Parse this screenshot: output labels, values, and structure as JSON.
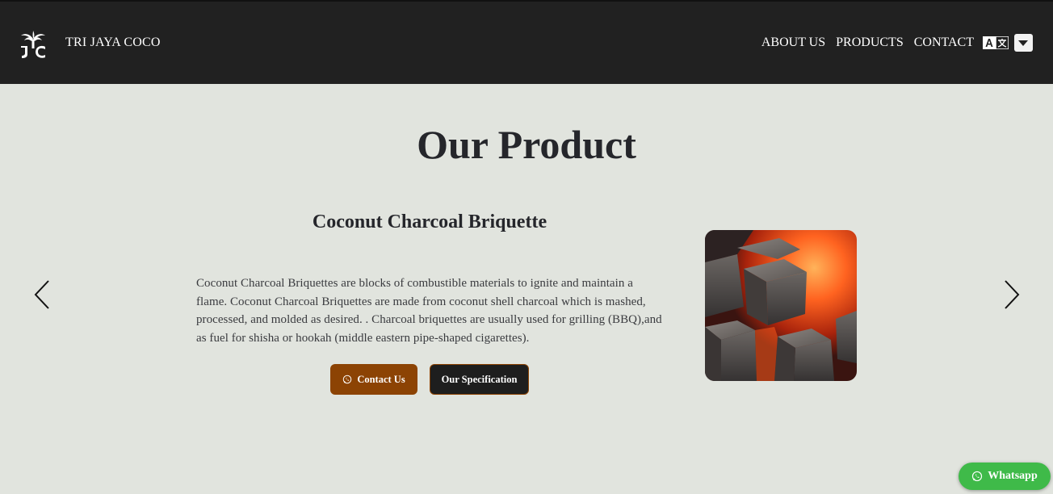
{
  "nav": {
    "brand": "TRI JAYA COCO",
    "logo_icon": "palm-tree-logo-icon",
    "links": [
      "ABOUT US",
      "PRODUCTS",
      "CONTACT"
    ],
    "language_icon": "translate-icon",
    "dropdown_icon": "caret-down-icon"
  },
  "main": {
    "heading": "Our Product",
    "product": {
      "title": "Coconut Charcoal Briquette",
      "description": "Coconut Charcoal Briquettes are blocks of combustible materials to ignite and maintain a flame. Coconut Charcoal Briquettes are made from coconut shell charcoal which is mashed, processed, and molded as desired. . Charcoal briquettes are usually used for grilling (BBQ),and as fuel for shisha or hookah (middle eastern pipe-shaped cigarettes).",
      "contact_label": "Contact Us",
      "spec_label": "Our Specification"
    }
  },
  "carousel": {
    "prev_icon": "chevron-left-icon",
    "next_icon": "chevron-right-icon"
  },
  "whatsapp": {
    "label": "Whatsapp"
  },
  "colors": {
    "navbar": "#212121",
    "background": "#e1e4de",
    "accent": "#8c4304",
    "whatsapp": "#3fba49"
  }
}
